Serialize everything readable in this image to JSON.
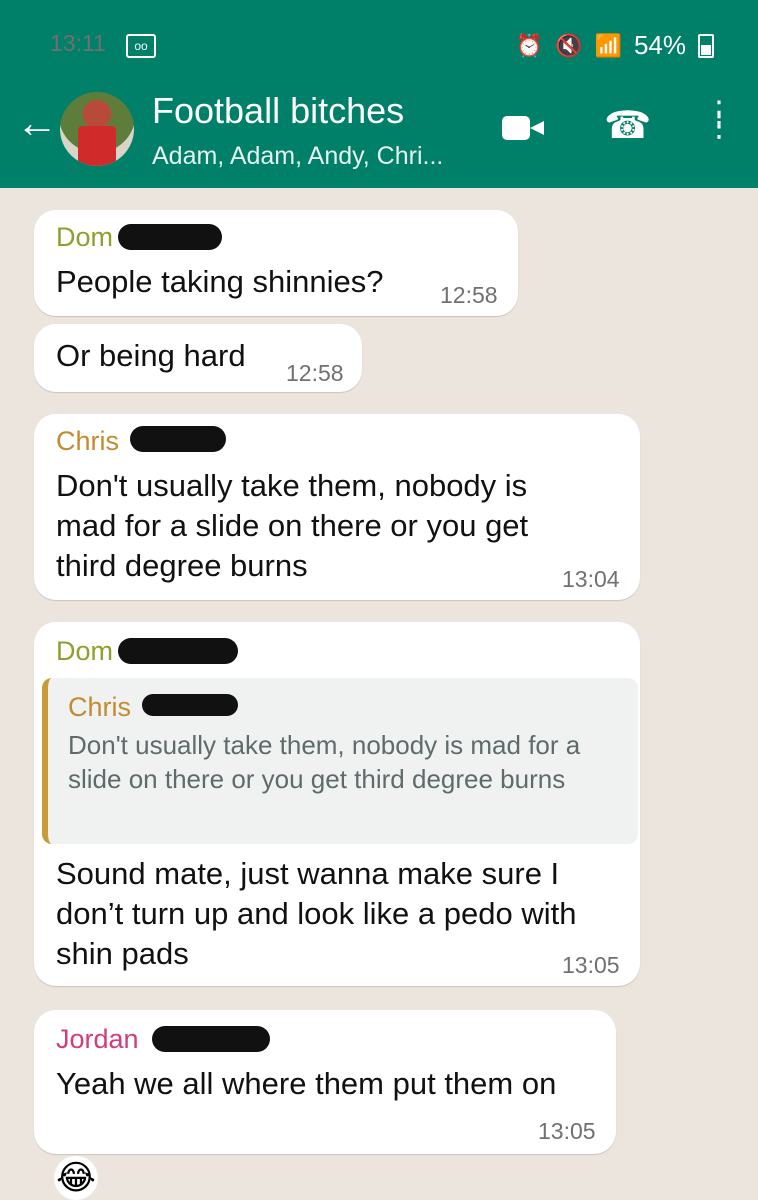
{
  "status": {
    "time": "13:11",
    "vm": "oo",
    "battery": "54%"
  },
  "header": {
    "title": "Football bitches",
    "subtitle": "Adam, Adam, Andy, Chri..."
  },
  "messages": [
    {
      "sender": "Dom",
      "text": "People taking shinnies?",
      "time": "12:58"
    },
    {
      "text": "Or being hard",
      "time": "12:58"
    },
    {
      "sender": "Chris",
      "text": "Don't usually take them, nobody is mad for a slide on there or you get third degree burns",
      "time": "13:04"
    },
    {
      "sender": "Dom",
      "quote": {
        "sender": "Chris",
        "text": "Don't usually take them, nobody is mad for a slide on there or you get third degree burns"
      },
      "text": "Sound mate, just wanna make sure I don’t turn up and look like a pedo with shin pads",
      "time": "13:05"
    },
    {
      "sender": "Jordan",
      "text": "Yeah we all where them put them on",
      "time": "13:05"
    }
  ],
  "reaction": "😂",
  "colors": {
    "header": "#008069",
    "dom": "#8ea02e",
    "chris": "#c48b2e",
    "jordan": "#d43a7c"
  }
}
